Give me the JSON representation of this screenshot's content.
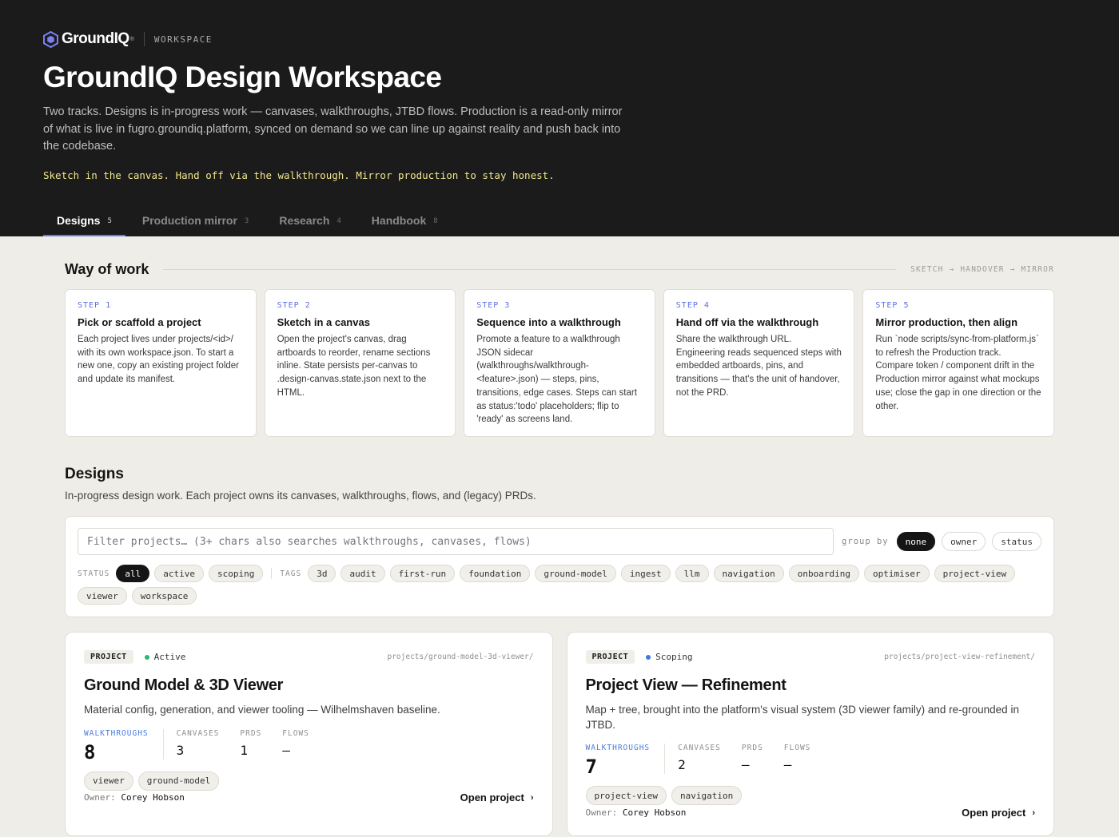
{
  "brand": {
    "name": "GroundIQ",
    "reg": "®",
    "workspace_label": "WORKSPACE"
  },
  "hero": {
    "title": "GroundIQ Design Workspace",
    "description": "Two tracks. Designs is in-progress work — canvases, walkthroughs, JTBD flows. Production is a read-only mirror of what is live in fugro.groundiq.platform, synced on demand so we can line up against reality and push back into the codebase.",
    "tagline": "Sketch in the canvas. Hand off via the walkthrough. Mirror production to stay honest."
  },
  "tabs": [
    {
      "label": "Designs",
      "count": "5",
      "active": true
    },
    {
      "label": "Production mirror",
      "count": "3"
    },
    {
      "label": "Research",
      "count": "4"
    },
    {
      "label": "Handbook",
      "count": "8"
    }
  ],
  "way_of_work": {
    "title": "Way of work",
    "flow": "SKETCH → HANDOVER → MIRROR",
    "steps": [
      {
        "label": "STEP 1",
        "title": "Pick or scaffold a project",
        "body": "Each project lives under projects/<id>/ with its own workspace.json. To start a new one, copy an existing project folder and update its manifest."
      },
      {
        "label": "STEP 2",
        "title": "Sketch in a canvas",
        "body": "Open the project's canvas, drag artboards to reorder, rename sections inline. State persists per-canvas to .design-canvas.state.json next to the HTML."
      },
      {
        "label": "STEP 3",
        "title": "Sequence into a walkthrough",
        "body": "Promote a feature to a walkthrough JSON sidecar (walkthroughs/walkthrough-<feature>.json) — steps, pins, transitions, edge cases. Steps can start as status:'todo' placeholders; flip to 'ready' as screens land."
      },
      {
        "label": "STEP 4",
        "title": "Hand off via the walkthrough",
        "body": "Share the walkthrough URL. Engineering reads sequenced steps with embedded artboards, pins, and transitions — that's the unit of handover, not the PRD."
      },
      {
        "label": "STEP 5",
        "title": "Mirror production, then align",
        "body": "Run `node scripts/sync-from-platform.js` to refresh the Production track. Compare token / component drift in the Production mirror against what mockups use; close the gap in one direction or the other."
      }
    ]
  },
  "designs": {
    "title": "Designs",
    "description": "In-progress design work. Each project owns its canvases, walkthroughs, flows, and (legacy) PRDs.",
    "filter_placeholder": "Filter projects… (3+ chars also searches walkthroughs, canvases, flows)",
    "group_by_label": "group by",
    "group_by_options": [
      "none",
      "owner",
      "status"
    ],
    "status_label": "STATUS",
    "status_options": [
      "all",
      "active",
      "scoping"
    ],
    "tags_label": "TAGS",
    "tags": [
      "3d",
      "audit",
      "first-run",
      "foundation",
      "ground-model",
      "ingest",
      "llm",
      "navigation",
      "onboarding",
      "optimiser",
      "project-view",
      "viewer",
      "workspace"
    ]
  },
  "projects": [
    {
      "badge": "PROJECT",
      "status": "Active",
      "status_color": "#2bb673",
      "path": "projects/ground-model-3d-viewer/",
      "title": "Ground Model & 3D Viewer",
      "description": "Material config, generation, and viewer tooling — Wilhelmshaven baseline.",
      "walkthroughs_label": "WALKTHROUGHS",
      "walkthroughs": "8",
      "canvases_label": "CANVASES",
      "canvases": "3",
      "prds_label": "PRDS",
      "prds": "1",
      "flows_label": "FLOWS",
      "flows": "—",
      "tags": [
        "viewer",
        "ground-model"
      ],
      "owner_label": "Owner:",
      "owner": "Corey Hobson",
      "open_label": "Open project"
    },
    {
      "badge": "PROJECT",
      "status": "Scoping",
      "status_color": "#3f78e0",
      "path": "projects/project-view-refinement/",
      "title": "Project View — Refinement",
      "description": "Map + tree, brought into the platform's visual system (3D viewer family) and re-grounded in JTBD.",
      "walkthroughs_label": "WALKTHROUGHS",
      "walkthroughs": "7",
      "canvases_label": "CANVASES",
      "canvases": "2",
      "prds_label": "PRDS",
      "prds": "—",
      "flows_label": "FLOWS",
      "flows": "—",
      "tags": [
        "project-view",
        "navigation"
      ],
      "owner_label": "Owner:",
      "owner": "Corey Hobson",
      "open_label": "Open project"
    }
  ]
}
